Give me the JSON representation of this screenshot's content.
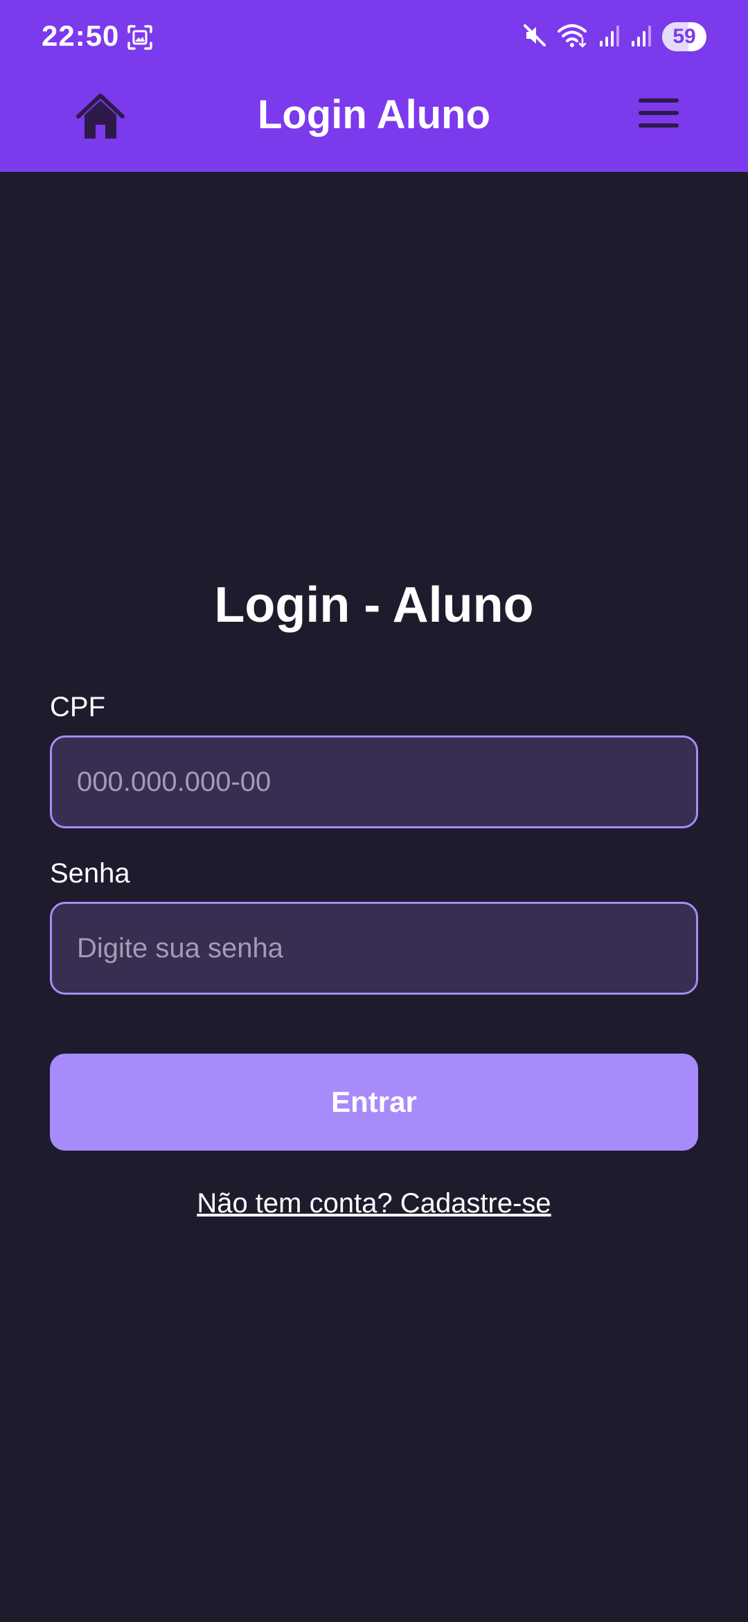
{
  "status_bar": {
    "time": "22:50",
    "battery_level": "59",
    "icons": [
      "screenshot-icon",
      "mute-icon",
      "wifi-icon",
      "signal-icon",
      "signal-icon",
      "battery-icon"
    ]
  },
  "header": {
    "title": "Login Aluno",
    "home_icon": "home-icon",
    "menu_icon": "hamburger-menu-icon"
  },
  "form": {
    "title": "Login - Aluno",
    "cpf_label": "CPF",
    "cpf_placeholder": "000.000.000-00",
    "cpf_value": "",
    "password_label": "Senha",
    "password_placeholder": "Digite sua senha",
    "password_value": "",
    "submit_label": "Entrar",
    "signup_link": "Não tem conta? Cadastre-se"
  },
  "colors": {
    "primary": "#7c3aed",
    "button": "#a78bfa",
    "background": "#1e1b2d",
    "input_background": "#372e52",
    "input_border": "#a78bfa",
    "header_icon": "#2e1a4a"
  }
}
